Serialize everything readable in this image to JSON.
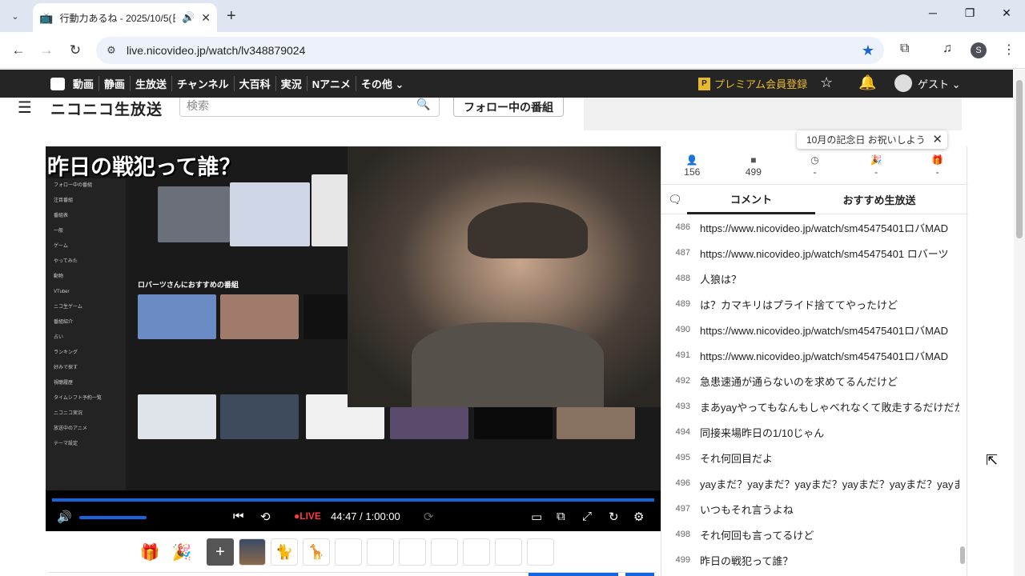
{
  "browser": {
    "tab_title": "行動力あるね - 2025/10/5(日",
    "url": "live.nicovideo.jp/watch/lv348879024",
    "profile_initial": "S",
    "new_tab": "+",
    "win_min": "─",
    "win_max": "❐",
    "win_close": "✕"
  },
  "nicobar": {
    "links": [
      "動画",
      "静画",
      "生放送",
      "チャンネル",
      "大百科",
      "実況",
      "Nアニメ",
      "その他 ⌄"
    ],
    "premium_label": "プレミアム会員登録",
    "premium_badge": "P",
    "user_label": "ゲスト ⌄"
  },
  "header": {
    "logo": "ニコニコ生放送",
    "search_placeholder": "検索",
    "follow_label": "フォロー中の番組"
  },
  "player": {
    "overlay_title": "昨日の戦犯って誰？",
    "section_label": "ロバーツさんにおすすめの番組",
    "sidebar_items": [
      "フォロー中の番組",
      "注目番組",
      "番組表",
      "一般",
      "ゲーム",
      "やってみた",
      "動物",
      "VTuber",
      "ニコ生ゲーム",
      "番組紹介",
      "占い",
      "ランキング",
      "好みで探す",
      "視聴履歴",
      "タイムシフト予約一覧",
      "ニコニコ実況",
      "放送中のアニメ",
      "テーマ設定"
    ],
    "live_label": "●LIVE",
    "time": "44:47 / 1:00:00",
    "volume_level": 0.95,
    "progress": 1.0
  },
  "tooltip": {
    "text": "10月の記念日 お祝いしよう"
  },
  "stats": [
    {
      "icon": "person-icon",
      "glyph": "👤",
      "value": "156"
    },
    {
      "icon": "comment-icon",
      "glyph": "■",
      "value": "499"
    },
    {
      "icon": "clock-icon",
      "glyph": "◷",
      "value": "-"
    },
    {
      "icon": "party-icon",
      "glyph": "🎉",
      "value": "-"
    },
    {
      "icon": "gift-icon",
      "glyph": "🎁",
      "value": "-"
    }
  ],
  "tabs": {
    "comment": "コメント",
    "recommend": "おすすめ生放送"
  },
  "comments": [
    {
      "no": "486",
      "text": "https://www.nicovideo.jp/watch/sm45475401ロバMAD"
    },
    {
      "no": "487",
      "text": "https://www.nicovideo.jp/watch/sm45475401 ロバーツ"
    },
    {
      "no": "488",
      "text": "人狼は？"
    },
    {
      "no": "489",
      "text": "は？カマキリはプライド捨ててやったけど"
    },
    {
      "no": "490",
      "text": "https://www.nicovideo.jp/watch/sm45475401ロバMAD"
    },
    {
      "no": "491",
      "text": "https://www.nicovideo.jp/watch/sm45475401ロバMAD"
    },
    {
      "no": "492",
      "text": "急患速通が通らないのを求めてるんだけど"
    },
    {
      "no": "493",
      "text": "まあyayやってもなんもしゃべれなくて敗走するだけだから"
    },
    {
      "no": "494",
      "text": "同接来場昨日の1/10じゃん"
    },
    {
      "no": "495",
      "text": "それ何回目だよ"
    },
    {
      "no": "496",
      "text": "yayまだ？yayまだ？yayまだ？yayまだ？yayまだ？yayまだ"
    },
    {
      "no": "497",
      "text": "いつもそれ言うよね"
    },
    {
      "no": "498",
      "text": "それ何回も言ってるけど"
    },
    {
      "no": "499",
      "text": "昨日の戦犯って誰？"
    }
  ],
  "gift_plus": "+"
}
